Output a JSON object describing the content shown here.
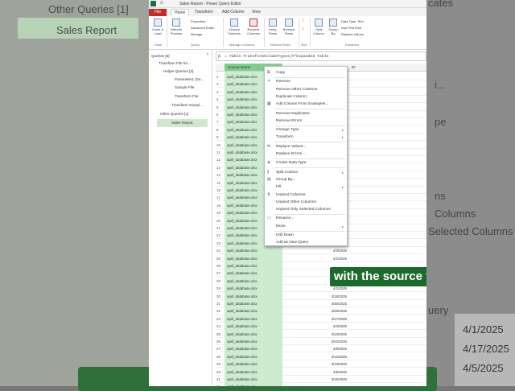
{
  "background": {
    "left_items": [
      "Other Queries [1]",
      "Sales Report"
    ],
    "right_items": [
      "cates",
      "i...",
      "pe",
      "ns",
      "Columns",
      "Selected Columns",
      "uery",
      "4/1/2025",
      "4/17/2025",
      "4/5/2025"
    ]
  },
  "window": {
    "title": "Sales Report - Power Query Editor",
    "tabs": [
      "File",
      "Home",
      "Transform",
      "Add Column",
      "View"
    ],
    "ribbon": {
      "close_load": "Close & Load",
      "refresh": "Refresh Preview",
      "properties": "Properties",
      "advanced_editor": "Advanced Editor",
      "manage": "Manage",
      "choose_columns": "Choose Columns",
      "remove_columns": "Remove Columns",
      "keep_rows": "Keep Rows",
      "remove_rows": "Remove Rows",
      "split_column": "Split Column",
      "group_by": "Group By",
      "data_type": "Data Type: Text",
      "use_first_row": "Use First Row",
      "replace_values": "Replace Values",
      "groups": [
        "Close",
        "Query",
        "Manage Columns",
        "Reduce Rows",
        "Sort",
        "Transform"
      ]
    },
    "queries_header": "Queries [5]",
    "queries": [
      "Transform File fro...",
      "Helper Queries [3]",
      "Parameter1 (Sa...",
      "Sample File",
      "Transform File",
      "Transform Sampl...",
      "Other Queries [1]",
      "Sales Report"
    ],
    "formula": "= Table.TransformColumnTypes(#\"Expanded Table",
    "columns": [
      "Source.Name",
      "Date",
      "ID"
    ],
    "rows": [
      {
        "n": "1",
        "name": "april_database.xlsx",
        "date": ""
      },
      {
        "n": "2",
        "name": "april_database.xlsx",
        "date": ""
      },
      {
        "n": "3",
        "name": "april_database.xlsx",
        "date": ""
      },
      {
        "n": "4",
        "name": "april_database.xlsx",
        "date": ""
      },
      {
        "n": "5",
        "name": "april_database.xlsx",
        "date": ""
      },
      {
        "n": "6",
        "name": "april_database.xlsx",
        "date": ""
      },
      {
        "n": "7",
        "name": "april_database.xlsx",
        "date": ""
      },
      {
        "n": "8",
        "name": "april_database.xlsx",
        "date": ""
      },
      {
        "n": "9",
        "name": "april_database.xlsx",
        "date": ""
      },
      {
        "n": "10",
        "name": "april_database.xlsx",
        "date": ""
      },
      {
        "n": "11",
        "name": "april_database.xlsx",
        "date": ""
      },
      {
        "n": "12",
        "name": "april_database.xlsx",
        "date": ""
      },
      {
        "n": "13",
        "name": "april_database.xlsx",
        "date": ""
      },
      {
        "n": "14",
        "name": "april_database.xlsx",
        "date": ""
      },
      {
        "n": "15",
        "name": "april_database.xlsx",
        "date": ""
      },
      {
        "n": "16",
        "name": "april_database.xlsx",
        "date": ""
      },
      {
        "n": "17",
        "name": "april_database.xlsx",
        "date": ""
      },
      {
        "n": "18",
        "name": "april_database.xlsx",
        "date": ""
      },
      {
        "n": "19",
        "name": "april_database.xlsx",
        "date": ""
      },
      {
        "n": "20",
        "name": "april_database.xlsx",
        "date": ""
      },
      {
        "n": "21",
        "name": "april_database.xlsx",
        "date": ""
      },
      {
        "n": "22",
        "name": "april_database.xlsx",
        "date": ""
      },
      {
        "n": "23",
        "name": "april_database.xlsx",
        "date": ""
      },
      {
        "n": "24",
        "name": "april_database.xlsx",
        "date": "4/3/2025"
      },
      {
        "n": "25",
        "name": "april_database.xlsx",
        "date": "4/1/2025"
      },
      {
        "n": "26",
        "name": "april_database.xlsx",
        "date": ""
      },
      {
        "n": "27",
        "name": "april_database.xlsx",
        "date": ""
      },
      {
        "n": "28",
        "name": "april_database.xlsx",
        "date": "4/5/2025"
      },
      {
        "n": "29",
        "name": "april_database.xlsx",
        "date": "4/1/2025"
      },
      {
        "n": "30",
        "name": "april_database.xlsx",
        "date": "4/18/2025"
      },
      {
        "n": "31",
        "name": "april_database.xlsx",
        "date": "4/30/2025"
      },
      {
        "n": "32",
        "name": "april_database.xlsx",
        "date": "4/28/2025"
      },
      {
        "n": "33",
        "name": "april_database.xlsx",
        "date": "4/17/2025"
      },
      {
        "n": "34",
        "name": "april_database.xlsx",
        "date": "4/4/2025"
      },
      {
        "n": "35",
        "name": "april_database.xlsx",
        "date": "4/13/2025"
      },
      {
        "n": "36",
        "name": "april_database.xlsx",
        "date": "4/22/2025"
      },
      {
        "n": "37",
        "name": "april_database.xlsx",
        "date": "4/8/2025"
      },
      {
        "n": "38",
        "name": "april_database.xlsx",
        "date": "4/12/2025"
      },
      {
        "n": "39",
        "name": "april_database.xlsx",
        "date": "4/13/2025"
      },
      {
        "n": "40",
        "name": "april_database.xlsx",
        "date": "4/5/2025"
      },
      {
        "n": "41",
        "name": "april_database.xlsx",
        "date": "4/18/2025"
      },
      {
        "n": "42",
        "name": "april_database.xlsx",
        "date": ""
      }
    ]
  },
  "context_menu": [
    {
      "label": "Copy",
      "icon": "copy-icon",
      "glyph": "⧉"
    },
    {
      "sep": true
    },
    {
      "label": "Remove",
      "icon": "remove-icon",
      "glyph": "✕"
    },
    {
      "label": "Remove Other Columns",
      "icon": "",
      "glyph": ""
    },
    {
      "label": "Duplicate Column",
      "icon": "",
      "glyph": ""
    },
    {
      "label": "Add Column From Examples...",
      "icon": "add-column-icon",
      "glyph": "▦"
    },
    {
      "sep": true
    },
    {
      "label": "Remove Duplicates",
      "icon": "",
      "glyph": ""
    },
    {
      "label": "Remove Errors",
      "icon": "",
      "glyph": ""
    },
    {
      "sep": true
    },
    {
      "label": "Change Type",
      "icon": "",
      "glyph": "",
      "sub": true
    },
    {
      "label": "Transform",
      "icon": "",
      "glyph": "",
      "sub": true
    },
    {
      "sep": true
    },
    {
      "label": "Replace Values...",
      "icon": "replace-icon",
      "glyph": "⇆"
    },
    {
      "label": "Replace Errors...",
      "icon": "",
      "glyph": ""
    },
    {
      "sep": true
    },
    {
      "label": "Create Data Type",
      "icon": "data-type-icon",
      "glyph": "◈"
    },
    {
      "sep": true
    },
    {
      "label": "Split Column",
      "icon": "split-icon",
      "glyph": "⫼",
      "sub": true
    },
    {
      "label": "Group By...",
      "icon": "group-icon",
      "glyph": "▤"
    },
    {
      "label": "Fill",
      "icon": "",
      "glyph": "",
      "sub": true
    },
    {
      "label": "Unpivot Columns",
      "icon": "unpivot-icon",
      "glyph": "⇅"
    },
    {
      "label": "Unpivot Other Columns",
      "icon": "",
      "glyph": ""
    },
    {
      "label": "Unpivot Only Selected Columns",
      "icon": "",
      "glyph": ""
    },
    {
      "sep": true
    },
    {
      "label": "Rename...",
      "icon": "rename-icon",
      "glyph": "▭"
    },
    {
      "label": "Move",
      "icon": "",
      "glyph": "",
      "sub": true
    },
    {
      "sep": true
    },
    {
      "label": "Drill Down",
      "icon": "",
      "glyph": ""
    },
    {
      "label": "Add as New Query",
      "icon": "",
      "glyph": ""
    }
  ],
  "caption": "with the source file name",
  "colors": {
    "file_tab": "#c62b2b",
    "selected_column": "#7dce8b",
    "caption_bg": "#1d6b2c"
  }
}
